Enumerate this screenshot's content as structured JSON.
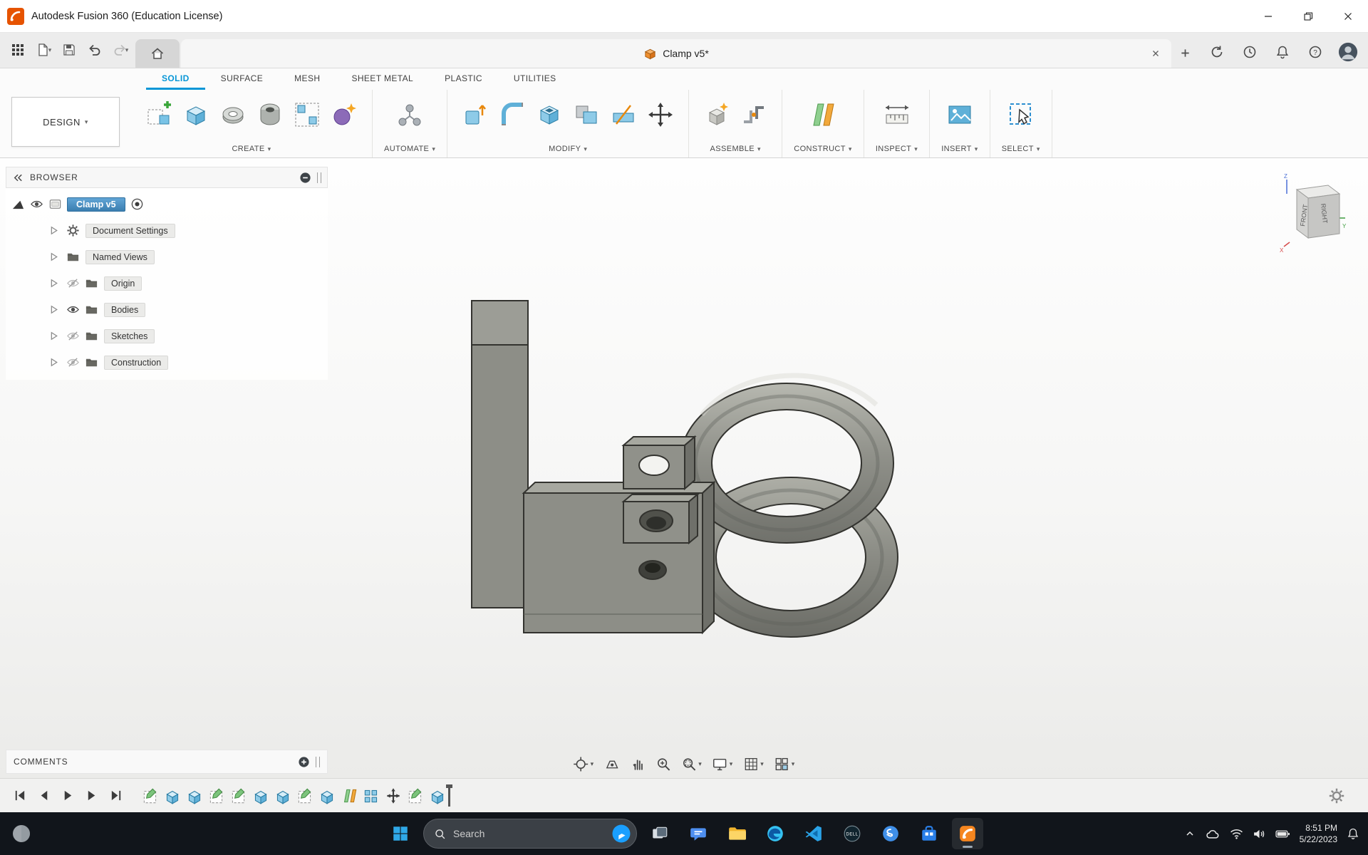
{
  "window": {
    "title": "Autodesk Fusion 360 (Education License)"
  },
  "toolbar": {
    "document_tab": "Clamp v5*"
  },
  "ribbon": {
    "design_label": "DESIGN",
    "tabs": [
      {
        "label": "SOLID",
        "active": true
      },
      {
        "label": "SURFACE",
        "active": false
      },
      {
        "label": "MESH",
        "active": false
      },
      {
        "label": "SHEET METAL",
        "active": false
      },
      {
        "label": "PLASTIC",
        "active": false
      },
      {
        "label": "UTILITIES",
        "active": false
      }
    ],
    "groups": [
      {
        "label": "CREATE",
        "icons": [
          "create-sketch",
          "extrude",
          "revolve",
          "hole",
          "pattern",
          "form"
        ]
      },
      {
        "label": "AUTOMATE",
        "icons": [
          "automate"
        ]
      },
      {
        "label": "MODIFY",
        "icons": [
          "press-pull",
          "fillet",
          "shell",
          "combine",
          "split",
          "move-copy"
        ]
      },
      {
        "label": "ASSEMBLE",
        "icons": [
          "new-component",
          "joint"
        ]
      },
      {
        "label": "CONSTRUCT",
        "icons": [
          "construct-plane"
        ]
      },
      {
        "label": "INSPECT",
        "icons": [
          "measure"
        ]
      },
      {
        "label": "INSERT",
        "icons": [
          "insert-image"
        ]
      },
      {
        "label": "SELECT",
        "icons": [
          "select-cursor"
        ]
      }
    ]
  },
  "browser": {
    "title": "BROWSER",
    "root_label": "Clamp v5",
    "items": [
      {
        "label": "Document Settings",
        "icons": [
          "gear"
        ]
      },
      {
        "label": "Named Views",
        "icons": [
          "folder"
        ]
      },
      {
        "label": "Origin",
        "icons": [
          "eye-off",
          "folder"
        ]
      },
      {
        "label": "Bodies",
        "icons": [
          "eye",
          "folder"
        ]
      },
      {
        "label": "Sketches",
        "icons": [
          "eye-off",
          "folder"
        ]
      },
      {
        "label": "Construction",
        "icons": [
          "eye-off",
          "folder"
        ]
      }
    ]
  },
  "viewcube": {
    "front_label": "FRONT",
    "right_label": "RIGHT"
  },
  "comments": {
    "label": "COMMENTS"
  },
  "navbar": {
    "icons": [
      {
        "name": "orbit",
        "caret": true
      },
      {
        "name": "look-at",
        "caret": false
      },
      {
        "name": "pan",
        "caret": false
      },
      {
        "name": "zoom",
        "caret": false
      },
      {
        "name": "fit",
        "caret": true
      },
      {
        "name": "display-settings",
        "caret": true
      },
      {
        "name": "grid-settings",
        "caret": true
      },
      {
        "name": "viewports",
        "caret": true
      }
    ]
  },
  "timeline": {
    "features": [
      "sketch",
      "extrude",
      "extrude",
      "sketch",
      "sketch",
      "extrude",
      "extrude",
      "sketch",
      "extrude",
      "mirror",
      "pattern",
      "move",
      "sketch",
      "extrude"
    ]
  },
  "taskbar": {
    "search_placeholder": "Search",
    "apps": [
      "task-view",
      "chat",
      "file-explorer",
      "edge",
      "vscode",
      "dell",
      "skype",
      "store",
      "fusion360"
    ],
    "active_app": "fusion360",
    "dell_label": "DELL",
    "clock": {
      "time": "8:51 PM",
      "date": "5/22/2023"
    }
  }
}
